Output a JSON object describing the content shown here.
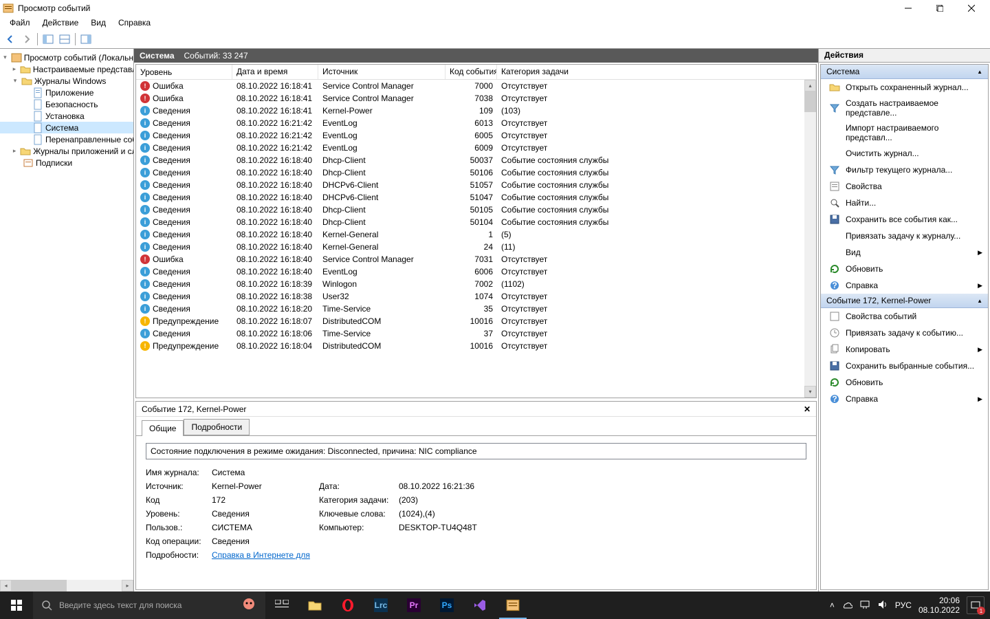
{
  "window": {
    "title": "Просмотр событий"
  },
  "menu": {
    "file": "Файл",
    "action": "Действие",
    "view": "Вид",
    "help": "Справка"
  },
  "tree": {
    "root": "Просмотр событий (Локальный)",
    "custom": "Настраиваемые представления",
    "winlogs": "Журналы Windows",
    "app": "Приложение",
    "security": "Безопасность",
    "setup": "Установка",
    "system": "Система",
    "forwarded": "Перенаправленные события",
    "appservices": "Журналы приложений и служб",
    "subscriptions": "Подписки"
  },
  "center": {
    "name": "Система",
    "count_label": "Событий: 33 247"
  },
  "columns": {
    "level": "Уровень",
    "datetime": "Дата и время",
    "source": "Источник",
    "eventid": "Код события",
    "task": "Категория задачи"
  },
  "events": [
    {
      "lvl": "error",
      "lvl_t": "Ошибка",
      "dt": "08.10.2022 16:18:41",
      "src": "Service Control Manager",
      "id": "7000",
      "task": "Отсутствует"
    },
    {
      "lvl": "error",
      "lvl_t": "Ошибка",
      "dt": "08.10.2022 16:18:41",
      "src": "Service Control Manager",
      "id": "7038",
      "task": "Отсутствует"
    },
    {
      "lvl": "info",
      "lvl_t": "Сведения",
      "dt": "08.10.2022 16:18:41",
      "src": "Kernel-Power",
      "id": "109",
      "task": "(103)"
    },
    {
      "lvl": "info",
      "lvl_t": "Сведения",
      "dt": "08.10.2022 16:21:42",
      "src": "EventLog",
      "id": "6013",
      "task": "Отсутствует"
    },
    {
      "lvl": "info",
      "lvl_t": "Сведения",
      "dt": "08.10.2022 16:21:42",
      "src": "EventLog",
      "id": "6005",
      "task": "Отсутствует"
    },
    {
      "lvl": "info",
      "lvl_t": "Сведения",
      "dt": "08.10.2022 16:21:42",
      "src": "EventLog",
      "id": "6009",
      "task": "Отсутствует"
    },
    {
      "lvl": "info",
      "lvl_t": "Сведения",
      "dt": "08.10.2022 16:18:40",
      "src": "Dhcp-Client",
      "id": "50037",
      "task": "Событие состояния службы"
    },
    {
      "lvl": "info",
      "lvl_t": "Сведения",
      "dt": "08.10.2022 16:18:40",
      "src": "Dhcp-Client",
      "id": "50106",
      "task": "Событие состояния службы"
    },
    {
      "lvl": "info",
      "lvl_t": "Сведения",
      "dt": "08.10.2022 16:18:40",
      "src": "DHCPv6-Client",
      "id": "51057",
      "task": "Событие состояния службы"
    },
    {
      "lvl": "info",
      "lvl_t": "Сведения",
      "dt": "08.10.2022 16:18:40",
      "src": "DHCPv6-Client",
      "id": "51047",
      "task": "Событие состояния службы"
    },
    {
      "lvl": "info",
      "lvl_t": "Сведения",
      "dt": "08.10.2022 16:18:40",
      "src": "Dhcp-Client",
      "id": "50105",
      "task": "Событие состояния службы"
    },
    {
      "lvl": "info",
      "lvl_t": "Сведения",
      "dt": "08.10.2022 16:18:40",
      "src": "Dhcp-Client",
      "id": "50104",
      "task": "Событие состояния службы"
    },
    {
      "lvl": "info",
      "lvl_t": "Сведения",
      "dt": "08.10.2022 16:18:40",
      "src": "Kernel-General",
      "id": "1",
      "task": "(5)"
    },
    {
      "lvl": "info",
      "lvl_t": "Сведения",
      "dt": "08.10.2022 16:18:40",
      "src": "Kernel-General",
      "id": "24",
      "task": "(11)"
    },
    {
      "lvl": "error",
      "lvl_t": "Ошибка",
      "dt": "08.10.2022 16:18:40",
      "src": "Service Control Manager",
      "id": "7031",
      "task": "Отсутствует"
    },
    {
      "lvl": "info",
      "lvl_t": "Сведения",
      "dt": "08.10.2022 16:18:40",
      "src": "EventLog",
      "id": "6006",
      "task": "Отсутствует"
    },
    {
      "lvl": "info",
      "lvl_t": "Сведения",
      "dt": "08.10.2022 16:18:39",
      "src": "Winlogon",
      "id": "7002",
      "task": "(1102)"
    },
    {
      "lvl": "info",
      "lvl_t": "Сведения",
      "dt": "08.10.2022 16:18:38",
      "src": "User32",
      "id": "1074",
      "task": "Отсутствует"
    },
    {
      "lvl": "info",
      "lvl_t": "Сведения",
      "dt": "08.10.2022 16:18:20",
      "src": "Time-Service",
      "id": "35",
      "task": "Отсутствует"
    },
    {
      "lvl": "warn",
      "lvl_t": "Предупреждение",
      "dt": "08.10.2022 16:18:07",
      "src": "DistributedCOM",
      "id": "10016",
      "task": "Отсутствует"
    },
    {
      "lvl": "info",
      "lvl_t": "Сведения",
      "dt": "08.10.2022 16:18:06",
      "src": "Time-Service",
      "id": "37",
      "task": "Отсутствует"
    },
    {
      "lvl": "warn",
      "lvl_t": "Предупреждение",
      "dt": "08.10.2022 16:18:04",
      "src": "DistributedCOM",
      "id": "10016",
      "task": "Отсутствует"
    }
  ],
  "detail": {
    "title": "Событие 172, Kernel-Power",
    "tab_general": "Общие",
    "tab_details": "Подробности",
    "message": "Состояние подключения в режиме ожидания: Disconnected, причина: NIC compliance",
    "labels": {
      "logname": "Имя журнала:",
      "source": "Источник:",
      "eventid": "Код",
      "level": "Уровень:",
      "user": "Пользов.:",
      "opcode": "Код операции:",
      "moreinfo": "Подробности:",
      "date": "Дата:",
      "taskcat": "Категория задачи:",
      "keywords": "Ключевые слова:",
      "computer": "Компьютер:"
    },
    "values": {
      "logname": "Система",
      "source": "Kernel-Power",
      "eventid": "172",
      "level": "Сведения",
      "user": "СИСТЕМА",
      "opcode": "Сведения",
      "moreinfo": "Справка в Интернете для",
      "date": "08.10.2022 16:21:36",
      "taskcat": "(203)",
      "keywords": "(1024),(4)",
      "computer": "DESKTOP-TU4Q48T"
    }
  },
  "actions": {
    "header": "Действия",
    "section1": "Система",
    "section2": "Событие 172, Kernel-Power",
    "open_saved": "Открыть сохраненный журнал...",
    "create_view": "Создать настраиваемое представле...",
    "import_view": "Импорт настраиваемого представл...",
    "clear_log": "Очистить журнал...",
    "filter_log": "Фильтр текущего журнала...",
    "properties": "Свойства",
    "find": "Найти...",
    "save_all": "Сохранить все события как...",
    "attach_task": "Привязать задачу к журналу...",
    "view": "Вид",
    "refresh": "Обновить",
    "help": "Справка",
    "event_props": "Свойства событий",
    "attach_task_evt": "Привязать задачу к событию...",
    "copy": "Копировать",
    "save_selected": "Сохранить выбранные события...",
    "refresh2": "Обновить",
    "help2": "Справка"
  },
  "taskbar": {
    "search_placeholder": "Введите здесь текст для поиска",
    "lang": "РУС",
    "time": "20:06",
    "date": "08.10.2022",
    "notif_count": "1"
  }
}
